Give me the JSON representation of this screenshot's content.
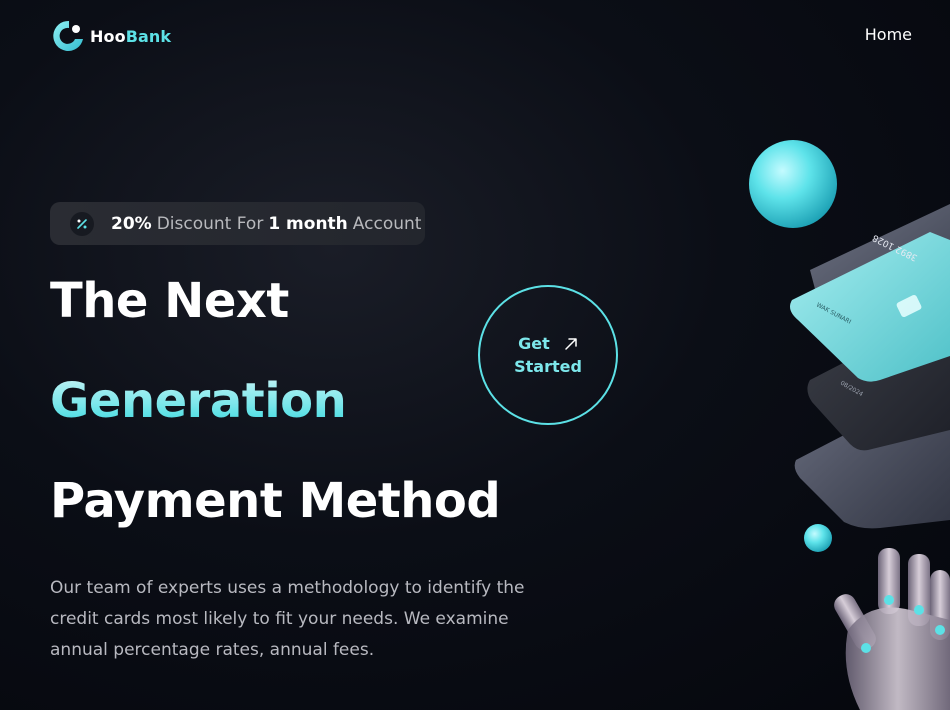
{
  "brand": {
    "name_part1": "Hoo",
    "name_part2": "Bank"
  },
  "nav": {
    "links": [
      {
        "label": "Home"
      }
    ]
  },
  "badge": {
    "percent": "20%",
    "text1": "Discount For",
    "duration": "1 month",
    "text2": "Account"
  },
  "hero": {
    "line1": "The Next",
    "line2": "Generation",
    "line3": "Payment Method",
    "description": "Our team of experts uses a methodology to identify the credit cards most likely to fit your needs. We examine annual percentage rates, annual fees."
  },
  "cta": {
    "line1": "Get",
    "line2": "Started"
  },
  "art": {
    "card_number": "3892 1028",
    "card_holder": "WAK SUNARI",
    "card_expiry": "08/2024"
  },
  "colors": {
    "accent": "#5ce1e6",
    "background": "#00040f",
    "text_muted": "#b8b9c0"
  },
  "icons": {
    "logo": "hoobank-logo-icon",
    "badge": "discount-percent-icon",
    "cta": "arrow-up-right-icon"
  }
}
